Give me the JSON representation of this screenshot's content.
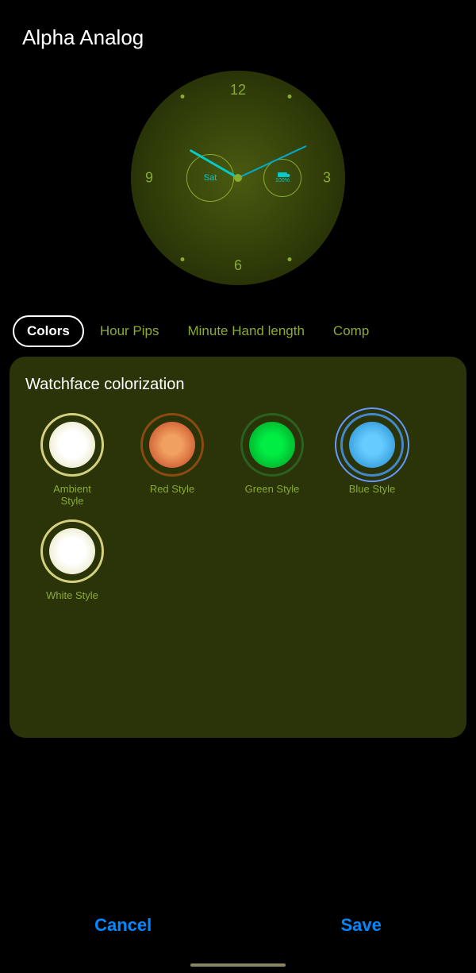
{
  "app": {
    "title": "Alpha Analog"
  },
  "watch": {
    "numbers": [
      "12",
      "3",
      "6",
      "9"
    ],
    "sub_dial_left_text": "Sat",
    "sub_dial_right_top": "",
    "sub_dial_right_pct": "100%"
  },
  "tabs": [
    {
      "id": "colors",
      "label": "Colors",
      "active": true
    },
    {
      "id": "hour-pips",
      "label": "Hour Pips",
      "active": false
    },
    {
      "id": "minute-hand",
      "label": "Minute Hand length",
      "active": false
    },
    {
      "id": "comp",
      "label": "Comp",
      "active": false
    }
  ],
  "section": {
    "title": "Watchface colorization"
  },
  "swatches": [
    {
      "id": "ambient",
      "label": "Ambient\nStyle",
      "class": "swatch-ambient",
      "selected": false
    },
    {
      "id": "red",
      "label": "Red Style",
      "class": "swatch-red",
      "selected": false
    },
    {
      "id": "green",
      "label": "Green Style",
      "class": "swatch-green",
      "selected": false
    },
    {
      "id": "blue",
      "label": "Blue Style",
      "class": "swatch-blue",
      "selected": true
    },
    {
      "id": "white",
      "label": "White Style",
      "class": "swatch-white",
      "selected": false
    }
  ],
  "buttons": {
    "cancel": "Cancel",
    "save": "Save"
  }
}
